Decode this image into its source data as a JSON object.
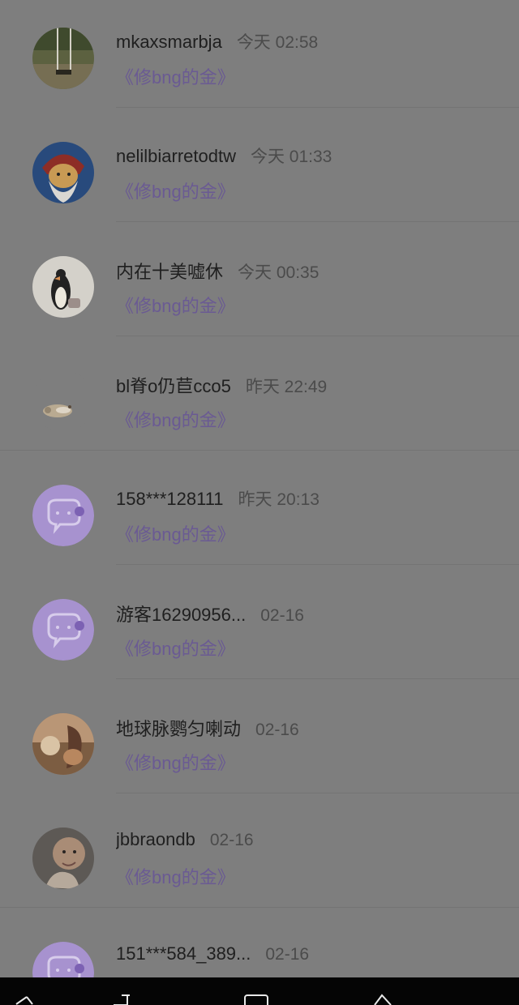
{
  "conversations": [
    {
      "name": "mkaxsmarbja",
      "time": "今天 02:58",
      "book": "《修bng的金》",
      "avatar": "swing-photo"
    },
    {
      "name": "nelilbiarretodtw",
      "time": "今天 01:33",
      "book": "《修bng的金》",
      "avatar": "dwarf-character"
    },
    {
      "name": "内在十美嘘休",
      "time": "今天 00:35",
      "book": "《修bng的金》",
      "avatar": "penguin-drawing"
    },
    {
      "name": "bl脊o仍苣cco5",
      "time": "昨天 22:49",
      "book": "《修bng的金》",
      "avatar": "small-animal"
    },
    {
      "name": "158***128111",
      "time": "昨天 20:13",
      "book": "《修bng的金》",
      "avatar": "default-chat"
    },
    {
      "name": "游客16290956...",
      "time": "02-16",
      "book": "《修bng的金》",
      "avatar": "default-chat"
    },
    {
      "name": "地球脉鹦匀喇动",
      "time": "02-16",
      "book": "《修bng的金》",
      "avatar": "sunset-photo"
    },
    {
      "name": "jbbraondb",
      "time": "02-16",
      "book": "《修bng的金》",
      "avatar": "baby-photo"
    },
    {
      "name": "151***584_389...",
      "time": "02-16",
      "book": "",
      "avatar": "default-chat"
    }
  ],
  "colors": {
    "overlay_background": "#7e7e7e",
    "book_title": "#6a5a93",
    "default_avatar": "#a792cf",
    "navigation_bar": "#050505"
  },
  "navigation": {
    "icons": [
      "back-icon",
      "recent-apps-icon",
      "home-icon",
      "down-icon"
    ]
  }
}
